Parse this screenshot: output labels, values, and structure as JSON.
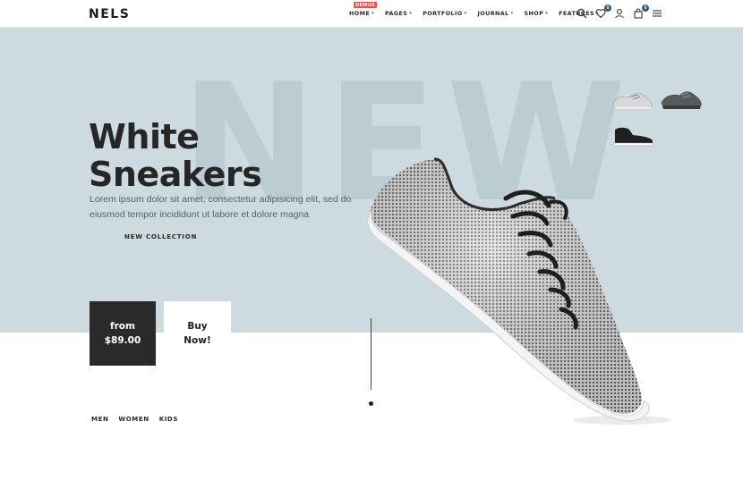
{
  "brand": {
    "logo": "NELS"
  },
  "nav": {
    "items": [
      {
        "label": "HOME",
        "badge": "DEMOS"
      },
      {
        "label": "PAGES"
      },
      {
        "label": "PORTFOLIO"
      },
      {
        "label": "JOURNAL"
      },
      {
        "label": "SHOP"
      },
      {
        "label": "FEATURES"
      }
    ],
    "caret": "▾"
  },
  "header_icons": {
    "search": "search-icon",
    "wishlist": {
      "icon": "heart-icon",
      "count": "0"
    },
    "account": "user-icon",
    "cart": {
      "icon": "shopping-bag-icon",
      "count": "0"
    },
    "menu": "hamburger-menu-icon"
  },
  "hero": {
    "background_word": "NEW",
    "title_line1": "White",
    "title_line2": "Sneakers",
    "subtitle": "Lorem ipsum dolor sit amet, consectetur adipisicing elit, sed do eiusmod tempor incididunt ut labore et dolore magna",
    "collection_link": "NEW COLLECTION",
    "thumbnails": [
      "white-sneaker-thumbnail",
      "dark-grey-sneaker-thumbnail",
      "black-high-top-thumbnail"
    ],
    "bg_color": "#cddbe0"
  },
  "price": {
    "line1": "from",
    "line2": "$89.00"
  },
  "buy": {
    "line1": "Buy",
    "line2": "Now!"
  },
  "categories": [
    "MEN",
    "WOMEN",
    "KIDS"
  ]
}
